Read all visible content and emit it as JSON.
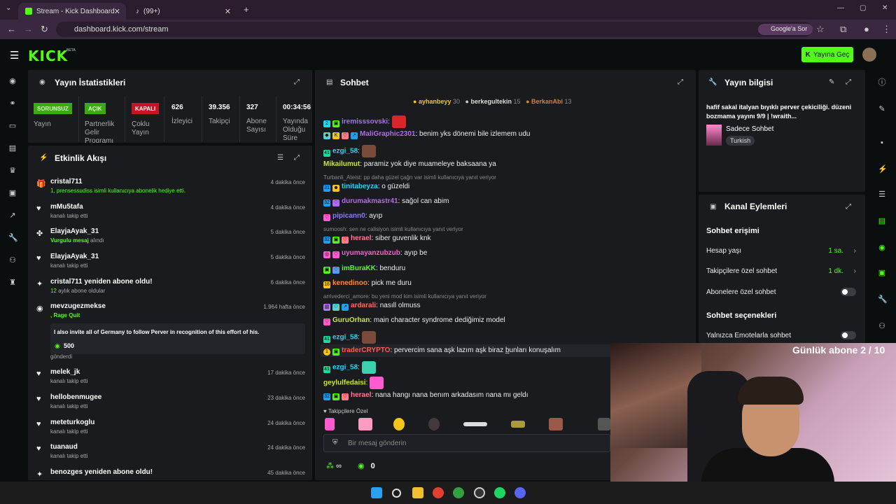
{
  "browser": {
    "tab1": "Stream - Kick Dashboard",
    "tab2": "(99+)",
    "url": "dashboard.kick.com/stream",
    "google_btn": "Google'a Sor"
  },
  "header": {
    "logo": "KICK",
    "beta": "BETA",
    "go_live": "Yayına Geç"
  },
  "stats": {
    "title": "Yayın İstatistikleri",
    "items": [
      {
        "badge": "SORUNSUZ",
        "label": "Yayın",
        "color": "#53fc18"
      },
      {
        "badge": "AÇIK",
        "label": "Partnerlik Gelir Programı",
        "color": "#53fc18"
      },
      {
        "badge": "KAPALI",
        "label": "Çoklu Yayın",
        "color": "#e0202a"
      },
      {
        "value": "626",
        "label": "İzleyici"
      },
      {
        "value": "39.356",
        "label": "Takipçi"
      },
      {
        "value": "327",
        "label": "Abone Sayısı"
      },
      {
        "value": "00:34:56",
        "label": "Yayında Olduğu Süre"
      }
    ]
  },
  "activity": {
    "title": "Etkinlik Akışı",
    "items": [
      {
        "name": "cristal711",
        "sub_green": "1",
        "sub": " prensessudiss isimli kullanıcıya abonelik hediye etti.",
        "time": "4 dakika önce"
      },
      {
        "name": "mMu5tafa",
        "sub": "kanalı takip etti",
        "time": "4 dakika önce"
      },
      {
        "name": "ElayjaAyak_31",
        "sub_green": "Vurgulu mesaj",
        "sub": " alındı",
        "time": "5 dakika önce"
      },
      {
        "name": "ElayjaAyak_31",
        "sub": "kanalı takip etti",
        "time": "5 dakika önce"
      },
      {
        "name": "cristal711 yeniden abone oldu!",
        "sub_green": "12",
        "sub": " aylık abone oldular",
        "time": "6 dakika önce"
      },
      {
        "name": "mevzugezmekse",
        "sub_green": ", Rage Quit",
        "time": "1.964 hafta önce",
        "msg": "I also invite all of Germany to follow Perver in recognition of this effort of his.",
        "amount": "500",
        "sent": "gönderdi"
      },
      {
        "name": "melek_jk",
        "sub": "kanalı takip etti",
        "time": "17 dakika önce"
      },
      {
        "name": "hellobenmugee",
        "sub": "kanalı takip etti",
        "time": "23 dakika önce"
      },
      {
        "name": "meteturkoglu",
        "sub": "kanalı takip etti",
        "time": "24 dakika önce"
      },
      {
        "name": "tuanaud",
        "sub": "kanalı takip etti",
        "time": "24 dakika önce"
      },
      {
        "name": "benozges yeniden abone oldu!",
        "time": "45 dakika önce"
      }
    ]
  },
  "chat": {
    "title": "Sohbet",
    "top": [
      {
        "name": "ayhanbeyy",
        "n": "30"
      },
      {
        "name": "berkegultekin",
        "n": "15"
      },
      {
        "name": "BerkanAbi",
        "n": "13"
      }
    ],
    "messages": [
      {
        "user": "iremisssovski",
        "color": "#b06af5",
        "text": ""
      },
      {
        "user": "MaliGraphic2301",
        "color": "#b06af5",
        "text": "benim yks dönemi bile izlemem udu"
      },
      {
        "user": "ezgi_58",
        "color": "#1ed8f0",
        "text": ""
      },
      {
        "user": "Mikailumut",
        "color": "#c8e830",
        "text": "paramiz yok diye muameleye baksaana ya"
      },
      {
        "reply": "Turbanli_Ateist: pp daha güzel çağrı var isimli kullanıcıya yanıt veriyor"
      },
      {
        "user": "tinitabeyza",
        "color": "#1ed8f0",
        "text": "o güzeldi"
      },
      {
        "user": "durumakmastr41",
        "color": "#b06af5",
        "text": "sağol can abim"
      },
      {
        "user": "pipicann0",
        "color": "#8a7af5",
        "text": "ayıp"
      },
      {
        "reply": "sumoosh: sen ne calisiyon isimli kullanıcıya yanıt veriyor"
      },
      {
        "user": "herael",
        "color": "#ff7a8a",
        "text": "siber guvenlik knk"
      },
      {
        "user": "uyumayanzubzub",
        "color": "#ff5ad0",
        "text": "ayıp be"
      },
      {
        "user": "imBuraKK",
        "color": "#53fc18",
        "text": "benduru"
      },
      {
        "user": "kenedinoo",
        "color": "#ff8a30",
        "text": "pick me duru"
      },
      {
        "reply": "arrivederci_amore: bu yeni mod kim isimli kullanıcıya yanıt veriyor"
      },
      {
        "user": "ardarali",
        "color": "#ff6a6a",
        "text": "nasıll olmuss"
      },
      {
        "user": "GuruOrhan",
        "color": "#c8e830",
        "text": "main character syndrome dediğimiz model"
      },
      {
        "user": "ezgi_58",
        "color": "#1ed8f0",
        "text": ""
      },
      {
        "user": "traderCRYPTO",
        "color": "#ff5a5a",
        "text": "pervercim sana aşk lazım aşk biraz b̲unları konuşalım"
      },
      {
        "user": "ezgi_58",
        "color": "#1ed8f0",
        "text": ""
      },
      {
        "user": "geylulfedaisi",
        "color": "#c8e830",
        "text": ""
      },
      {
        "user": "herael",
        "color": "#ff7a8a",
        "text": "nana hangı nana benım arkadasım nana mı geldı"
      }
    ],
    "followers_only": "Takipçilere Özel",
    "placeholder": "Bir mesaj gönderin",
    "infinity": "∞",
    "count": "0"
  },
  "info": {
    "title": "Yayın bilgisi",
    "stream_title": "hafif sakal italyan bıyıklı perver çekiciliği. düzeni bozmama yayını 9/9 | !wraith...",
    "category": "Sadece Sohbet",
    "lang": "Turkish"
  },
  "actions": {
    "title": "Kanal Eylemleri",
    "access": "Sohbet erişimi",
    "rows": [
      {
        "label": "Hesap yaşı",
        "value": "1 sa."
      },
      {
        "label": "Takipçilere özel sohbet",
        "value": "1 dk."
      },
      {
        "label": "Abonelere özel sohbet"
      }
    ],
    "options": "Sohbet seçenekleri",
    "emote_only": "Yalnızca Emotelarla sohbet"
  },
  "overlay": {
    "counter": "Günlük abone 2 / 10"
  }
}
